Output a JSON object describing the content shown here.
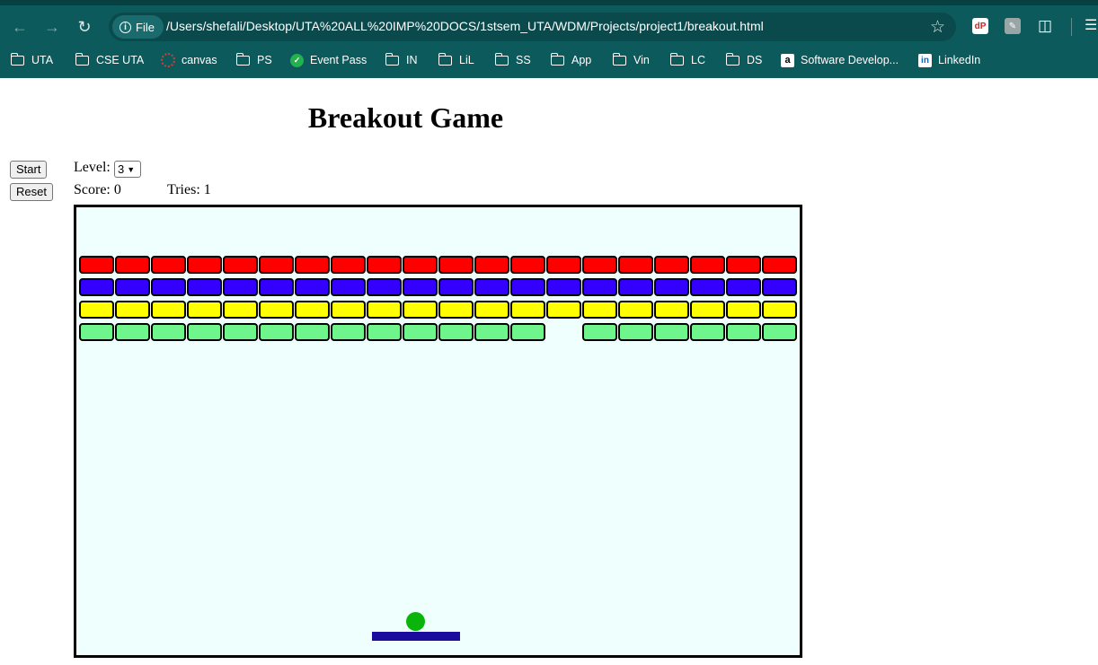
{
  "browser": {
    "file_chip_label": "File",
    "url": "/Users/shefali/Desktop/UTA%20ALL%20IMP%20DOCS/1stsem_UTA/WDM/Projects/project1/breakout.html",
    "ext_dp_label": "dP",
    "bookmarks": [
      {
        "label": "UTA",
        "icon": "folder-icon"
      },
      {
        "label": "CSE UTA",
        "icon": "folder-icon"
      },
      {
        "label": "canvas",
        "icon": "canvas-icon"
      },
      {
        "label": "PS",
        "icon": "folder-icon"
      },
      {
        "label": "Event Pass",
        "icon": "event-pass-icon"
      },
      {
        "label": "IN",
        "icon": "folder-icon"
      },
      {
        "label": "LiL",
        "icon": "folder-icon"
      },
      {
        "label": "SS",
        "icon": "folder-icon"
      },
      {
        "label": "App",
        "icon": "folder-icon"
      },
      {
        "label": "Vin",
        "icon": "folder-icon"
      },
      {
        "label": "LC",
        "icon": "folder-icon"
      },
      {
        "label": "DS",
        "icon": "folder-icon"
      },
      {
        "label": "Software Develop...",
        "icon": "amazon-icon"
      },
      {
        "label": "LinkedIn",
        "icon": "linkedin-icon"
      }
    ]
  },
  "game": {
    "title": "Breakout Game",
    "start_label": "Start",
    "reset_label": "Reset",
    "level_label": "Level:",
    "level_value": "3",
    "score_label": "Score: 0",
    "tries_label": "Tries: 1",
    "colors": {
      "board_bg": "#effffe",
      "ball": "#0ab40a",
      "paddle": "#1b0c9e"
    },
    "brick_rows": [
      {
        "color": "#ff0000",
        "bricks": [
          1,
          1,
          1,
          1,
          1,
          1,
          1,
          1,
          1,
          1,
          1,
          1,
          1,
          1,
          1,
          1,
          1,
          1,
          1,
          1
        ]
      },
      {
        "color": "#3300ff",
        "bricks": [
          1,
          1,
          1,
          1,
          1,
          1,
          1,
          1,
          1,
          1,
          1,
          1,
          1,
          1,
          1,
          1,
          1,
          1,
          1,
          1
        ]
      },
      {
        "color": "#ffff00",
        "bricks": [
          1,
          1,
          1,
          1,
          1,
          1,
          1,
          1,
          1,
          1,
          1,
          1,
          1,
          1,
          1,
          1,
          1,
          1,
          1,
          1
        ]
      },
      {
        "color": "#6ef58c",
        "bricks": [
          1,
          1,
          1,
          1,
          1,
          1,
          1,
          1,
          1,
          1,
          1,
          1,
          1,
          0,
          1,
          1,
          1,
          1,
          1,
          1
        ]
      }
    ]
  }
}
